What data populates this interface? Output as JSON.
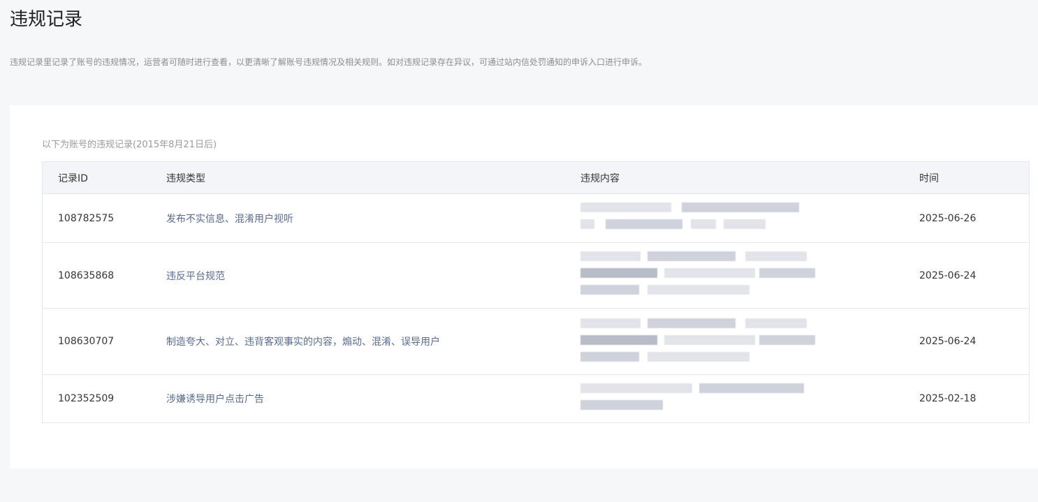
{
  "page": {
    "title": "违规记录",
    "description": "违规记录里记录了账号的违规情况，运营者可随时进行查看，以更清晰了解账号违规情况及相关规则。如对违规记录存在异议，可通过站内信处罚通知的申诉入口进行申诉。"
  },
  "table": {
    "caption": "以下为账号的违规记录(2015年8月21日后)",
    "headers": {
      "id": "记录ID",
      "type": "违规类型",
      "content": "违规内容",
      "time": "时间"
    },
    "rows": [
      {
        "id": "108782575",
        "type": "发布不实信息、混淆用户视听",
        "time": "2025-06-26"
      },
      {
        "id": "108635868",
        "type": "违反平台规范",
        "time": "2025-06-24"
      },
      {
        "id": "108630707",
        "type": "制造夸大、对立、违背客观事实的内容，煽动、混淆、误导用户",
        "time": "2025-06-24"
      },
      {
        "id": "102352509",
        "type": "涉嫌诱导用户点击广告",
        "time": "2025-02-18"
      }
    ]
  },
  "colors": {
    "background": "#f6f7f9",
    "card": "#ffffff",
    "link": "#576b95",
    "header_bg": "#f4f5f9",
    "border": "#e4e8eb",
    "muted_text": "#8d8d8d"
  }
}
